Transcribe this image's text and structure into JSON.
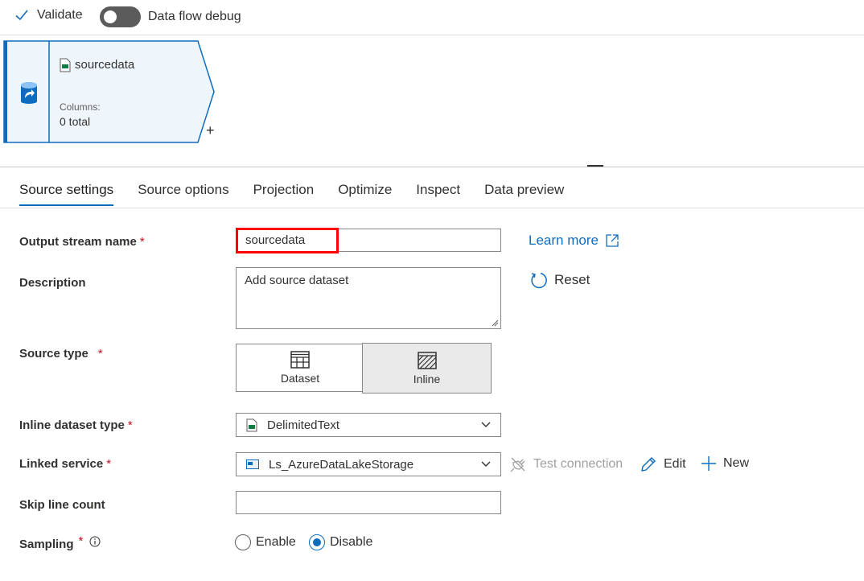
{
  "toolbar": {
    "validate_label": "Validate",
    "debug_label": "Data flow debug",
    "debug_on": false
  },
  "node": {
    "title": "sourcedata",
    "columns_label": "Columns:",
    "columns_value": "0 total",
    "add_symbol": "+"
  },
  "tabs": [
    {
      "label": "Source settings",
      "active": true
    },
    {
      "label": "Source options",
      "active": false
    },
    {
      "label": "Projection",
      "active": false
    },
    {
      "label": "Optimize",
      "active": false
    },
    {
      "label": "Inspect",
      "active": false
    },
    {
      "label": "Data preview",
      "active": false
    }
  ],
  "form": {
    "output_stream": {
      "label": "Output stream name",
      "required": "*",
      "value": "sourcedata"
    },
    "description": {
      "label": "Description",
      "value": "Add source dataset"
    },
    "source_type": {
      "label": "Source type",
      "required": "*",
      "options": [
        "Dataset",
        "Inline"
      ],
      "selected": "Inline"
    },
    "inline_dataset_type": {
      "label": "Inline dataset type",
      "required": "*",
      "value": "DelimitedText"
    },
    "linked_service": {
      "label": "Linked service",
      "required": "*",
      "value": "Ls_AzureDataLakeStorage"
    },
    "skip_line_count": {
      "label": "Skip line count",
      "value": ""
    },
    "sampling": {
      "label": "Sampling",
      "required": "*",
      "options": [
        "Enable",
        "Disable"
      ],
      "selected": "Disable"
    }
  },
  "actions": {
    "learn_more": "Learn more",
    "reset": "Reset",
    "test_connection": "Test connection",
    "edit": "Edit",
    "new": "New"
  },
  "colors": {
    "accent": "#0f6cbd",
    "highlight": "#ff0000",
    "required": "#c50f1f"
  }
}
